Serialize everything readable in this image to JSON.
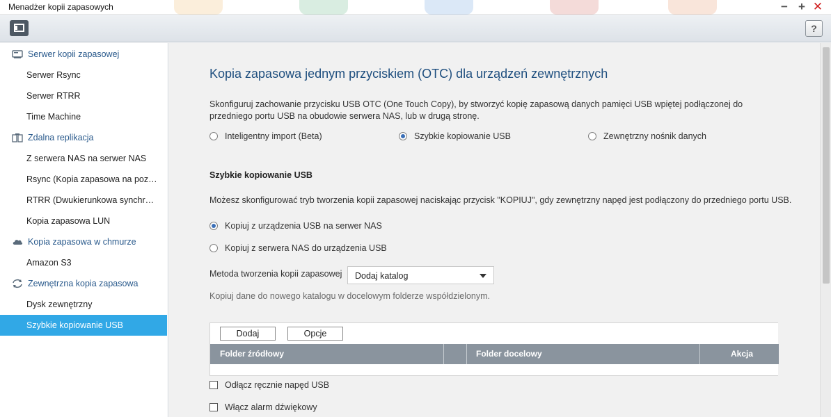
{
  "window": {
    "title": "Menadżer kopii zapasowych",
    "minimize": "−",
    "maximize": "+",
    "close": "✕"
  },
  "toolbar": {
    "help_label": "?"
  },
  "sidebar": {
    "sections": [
      {
        "label": "Serwer kopii zapasowej",
        "icon": "server-icon",
        "items": [
          "Serwer Rsync",
          "Serwer RTRR",
          "Time Machine"
        ]
      },
      {
        "label": "Zdalna replikacja",
        "icon": "replication-icon",
        "items": [
          "Z serwera NAS na serwer NAS",
          "Rsync (Kopia zapasowa na poziomie plików)",
          "RTRR (Dwukierunkowa synchronizacja)",
          "Kopia zapasowa LUN"
        ]
      },
      {
        "label": "Kopia zapasowa w chmurze",
        "icon": "cloud-icon",
        "items": [
          "Amazon S3"
        ]
      },
      {
        "label": "Zewnętrzna kopia zapasowa",
        "icon": "sync-arrows-icon",
        "items": [
          "Dysk zewnętrzny",
          "Szybkie kopiowanie USB"
        ]
      }
    ],
    "active_item": "Szybkie kopiowanie USB"
  },
  "main": {
    "title": "Kopia zapasowa jednym przyciskiem (OTC) dla urządzeń zewnętrznych",
    "description": "Skonfiguruj zachowanie przycisku USB OTC (One Touch Copy), by stworzyć kopię zapasową danych pamięci USB wpiętej podłączonej do przedniego portu USB na obudowie serwera NAS, lub w drugą stronę.",
    "mode_options": [
      {
        "label": "Inteligentny import (Beta)",
        "selected": false
      },
      {
        "label": "Szybkie kopiowanie USB",
        "selected": true
      },
      {
        "label": "Zewnętrzny nośnik danych",
        "selected": false
      }
    ],
    "section_title": "Szybkie kopiowanie USB",
    "section_desc": "Możesz skonfigurować tryb tworzenia kopii zapasowej naciskając przycisk \"KOPIUJ\", gdy zewnętrzny napęd jest podłączony do przedniego portu USB.",
    "direction_options": [
      {
        "label": "Kopiuj z urządzenia USB na serwer NAS",
        "selected": true
      },
      {
        "label": "Kopiuj z serwera NAS do urządzenia USB",
        "selected": false
      }
    ],
    "method_label": "Metoda tworzenia kopii zapasowej",
    "method_value": "Dodaj katalog",
    "method_hint": "Kopiuj dane do nowego katalogu w docelowym folderze współdzielonym.",
    "table": {
      "add_label": "Dodaj",
      "options_label": "Opcje",
      "columns": [
        "Folder źródłowy",
        "",
        "Folder docelowy",
        "Akcja"
      ],
      "rows": []
    },
    "checkboxes": [
      {
        "label": "Odłącz ręcznie napęd USB",
        "checked": false
      },
      {
        "label": "Włącz alarm dźwiękowy",
        "checked": false
      }
    ]
  },
  "colors": {
    "accent": "#31a8e6",
    "title": "#1f4f7f",
    "section_label": "#2a5a8c",
    "table_header": "#8a949e",
    "close": "#d02020"
  }
}
